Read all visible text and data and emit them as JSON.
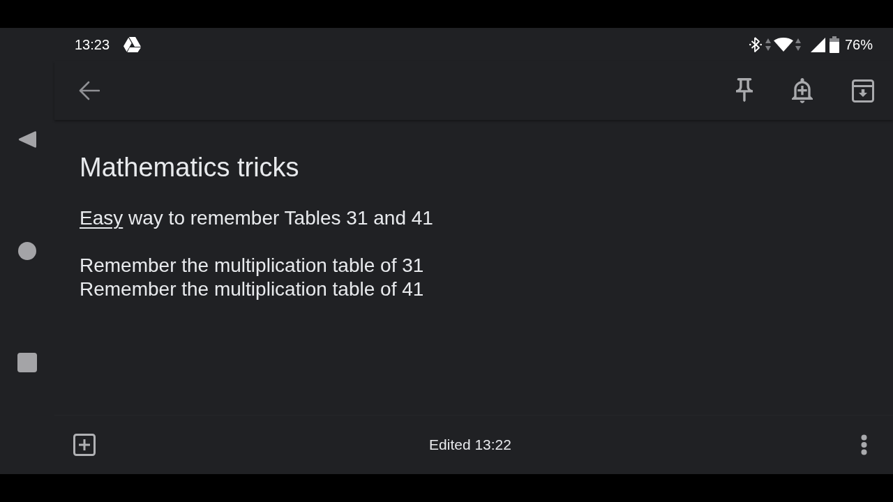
{
  "status_bar": {
    "time": "13:23",
    "battery": "76%"
  },
  "note": {
    "title": "Mathematics tricks",
    "paragraphs": [
      {
        "lines": [
          {
            "segments": [
              {
                "text": "Easy",
                "underlined": true
              },
              {
                "text": " way to remember Tables 31 and 41",
                "underlined": false
              }
            ]
          }
        ]
      },
      {
        "lines": [
          {
            "segments": [
              {
                "text": "Remember the multiplication table of 31",
                "underlined": false
              }
            ]
          },
          {
            "segments": [
              {
                "text": "Remember the multiplication table of 41",
                "underlined": false
              }
            ]
          }
        ]
      }
    ]
  },
  "footer": {
    "edited": "Edited 13:22"
  }
}
